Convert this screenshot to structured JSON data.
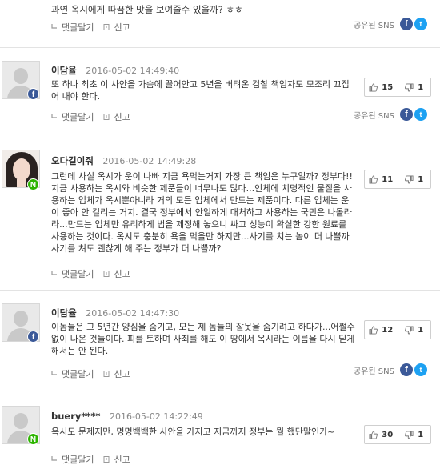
{
  "labels": {
    "reply": "댓글달기",
    "report": "신고",
    "share": "공유된 SNS",
    "facebook_glyph": "f",
    "twitter_glyph": "t",
    "badge_facebook": "f",
    "badge_naver": "N"
  },
  "top_cut": {
    "text": "과연 옥시에게 따끔한 맛을 보여줄수 있을까? ㅎㅎ"
  },
  "comments": [
    {
      "author": "이담율",
      "date": "2016-05-02 14:49:40",
      "text": "또 하나 최초 이 사안을 가슴에 끌어안고 5년을 버텨온 검찰 책임자도 모조리 끄집어 내야 한다.",
      "likes": "15",
      "dislikes": "1",
      "avatar": "default",
      "badge": "facebook",
      "shared": true
    },
    {
      "author": "오다길이줘",
      "date": "2016-05-02 14:49:28",
      "text": "그런데 사실 옥시가 운이 나빠 지금 욕먹는거지 가장 큰 책임은 누구일까? 정부다!! 지금 사용하는 옥시와 비슷한 제품들이 너무나도 많다...인체에 치명적인 물질을 사용하는 업체가 옥시뿐아니라 거의 모든 업체에서 만드는 제품이다. 다른 업체는 운이 좋아 안 걸리는 거지. 결국 정부에서 안일하게 대처하고 사용하는 국민은 나몰라라...만드는 업체만 유리하게 법을 제정해 놓으니 싸고 성능이 확실한 강한 원료를 사용하는 것이다. 옥시도 충분히 욕을 먹을만 하지만...사기를 치는 놈이 더 나쁠까 사기를 쳐도 괜찮게 해 주는 정부가 더 나쁠까?",
      "likes": "11",
      "dislikes": "1",
      "avatar": "photo",
      "badge": "naver",
      "shared": false
    },
    {
      "author": "이담율",
      "date": "2016-05-02 14:47:30",
      "text": "이놈들은 그 5년간 양심을 숨기고, 모든 제 놈들의 잘못을 숨기려고 하다가...어쩔수 없이 나온 것들이다. 피를 토하며 사죄를 해도 이 땅에서 옥시라는 이름을 다시 딛게 해서는 안 된다.",
      "likes": "12",
      "dislikes": "1",
      "avatar": "default",
      "badge": "facebook",
      "shared": true
    },
    {
      "author": "buery****",
      "date": "2016-05-02 14:22:49",
      "text": "옥시도 문제지만, 명명백백한 사안을 가지고 지금까지 정부는 뭘 했단말인가~",
      "likes": "30",
      "dislikes": "1",
      "avatar": "default",
      "badge": "naver",
      "shared": false
    }
  ]
}
